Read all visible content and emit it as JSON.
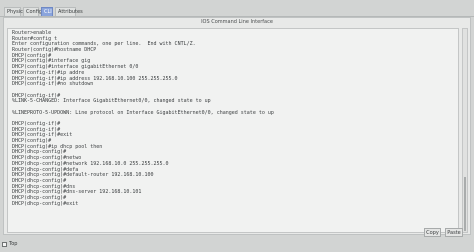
{
  "tabs": [
    {
      "label": "Physical"
    },
    {
      "label": "Config"
    },
    {
      "label": "CLI"
    },
    {
      "label": "Attributes"
    }
  ],
  "panel_title": "IOS Command Line Interface",
  "console_lines": [
    "Router>enable",
    "Router#config t",
    "Enter configuration commands, one per line.  End with CNTL/Z.",
    "Router(config)#hostname DHCP",
    "DHCP(config)#",
    "DHCP(config)#interface gig",
    "DHCP(config)#interface gigabitEthernet 0/0",
    "DHCP(config-if)#ip addre",
    "DHCP(config-if)#ip address 192.168.10.100 255.255.255.0",
    "DHCP(config-if)#no shutdown",
    "",
    "DHCP(config-if)#",
    "%LINK-5-CHANGED: Interface GigabitEthernet0/0, changed state to up",
    "",
    "%LINEPROTO-5-UPDOWN: Line protocol on Interface GigabitEthernet0/0, changed state to up",
    "",
    "DHCP(config-if)#",
    "DHCP(config-if)#",
    "DHCP(config-if)#exit",
    "DHCP(config)#",
    "DHCP(config)#ip dhcp pool then",
    "DHCP(dhcp-config)#",
    "DHCP(dhcp-config)#netwo",
    "DHCP(dhcp-config)#network 192.168.10.0 255.255.255.0",
    "DHCP(dhcp-config)#defa",
    "DHCP(dhcp-config)#default-router 192.168.10.100",
    "DHCP(dhcp-config)#",
    "DHCP(dhcp-config)#dns",
    "DHCP(dhcp-config)#dns-server 192.168.10.101",
    "DHCP(dhcp-config)#",
    "DHCP(dhcp-config)#exit"
  ],
  "buttons": {
    "copy": "Copy",
    "paste": "Paste"
  },
  "bottom_checkbox": {
    "label": "Top"
  },
  "colors": {
    "active_tab": "#8aa4dc",
    "background": "#d2d4d3",
    "console_bg": "#f1f2f1"
  }
}
